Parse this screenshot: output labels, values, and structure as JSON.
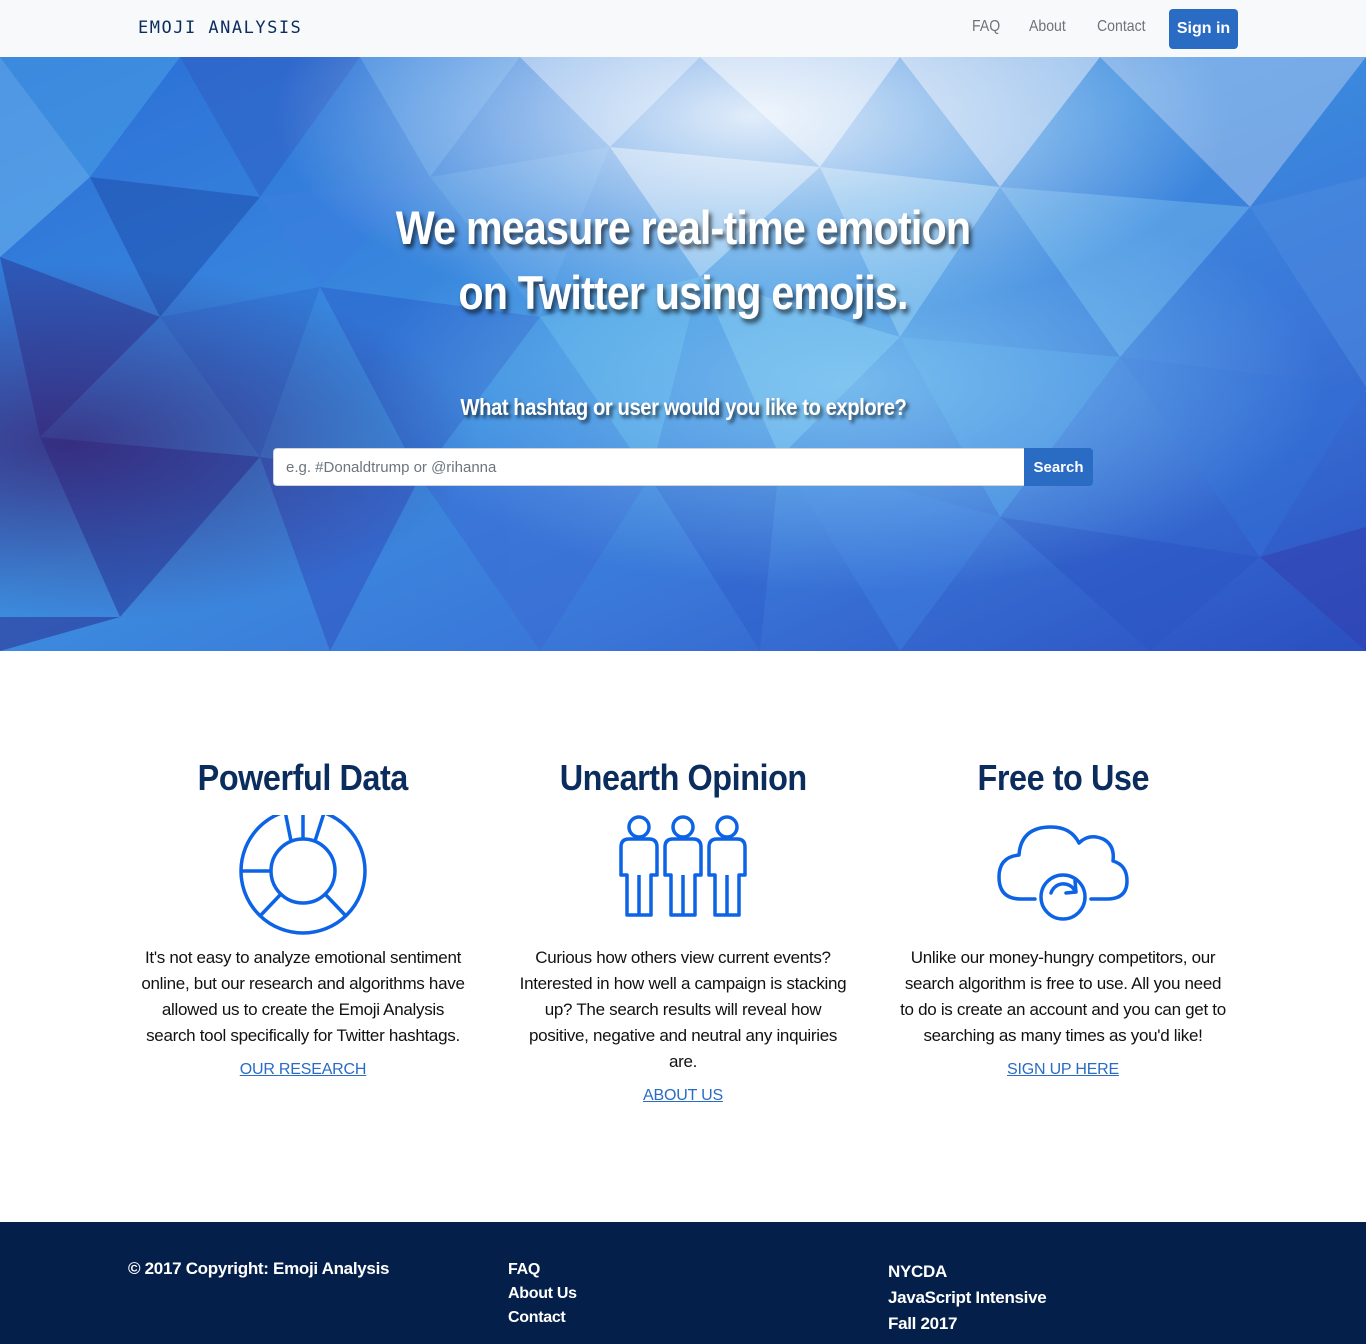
{
  "nav": {
    "brand": "EMOJI ANALYSIS",
    "links": [
      "FAQ",
      "About",
      "Contact"
    ],
    "signin_label": "Sign in"
  },
  "hero": {
    "title_line1": "We measure real-time emotion",
    "title_line2": "on Twitter using emojis.",
    "question": "What hashtag or user would you like to explore?",
    "search_placeholder": "e.g. #Donaldtrump or @rihanna",
    "search_value": "",
    "search_button": "Search"
  },
  "features": [
    {
      "title": "Powerful Data",
      "icon": "donut-chart-icon",
      "text": "It's not easy to analyze emotional sentiment online, but our research and algorithms have allowed us to create the Emoji Analysis search tool specifically for Twitter hashtags.",
      "link": "OUR RESEARCH"
    },
    {
      "title": "Unearth Opinion",
      "icon": "people-icon",
      "text": "Curious how others view current events? Interested in how well a campaign is stacking up? The search results will reveal how positive, negative and neutral any inquiries are.",
      "link": "ABOUT US"
    },
    {
      "title": "Free to Use",
      "icon": "cloud-sync-icon",
      "text": "Unlike our money-hungry competitors, our search algorithm is free to use. All you need to do is create an account and you can get to searching as many times as you'd like!",
      "link": "SIGN UP HERE"
    }
  ],
  "footer": {
    "copyright": "© 2017 Copyright: Emoji Analysis",
    "links": [
      "FAQ",
      "About Us",
      "Contact"
    ],
    "info": [
      "NYCDA",
      "JavaScript Intensive",
      "Fall 2017"
    ]
  },
  "colors": {
    "brand_navy": "#0b2d5e",
    "accent_blue": "#2a6bc4",
    "icon_blue": "#0d63e6",
    "footer_bg": "#04204a"
  }
}
